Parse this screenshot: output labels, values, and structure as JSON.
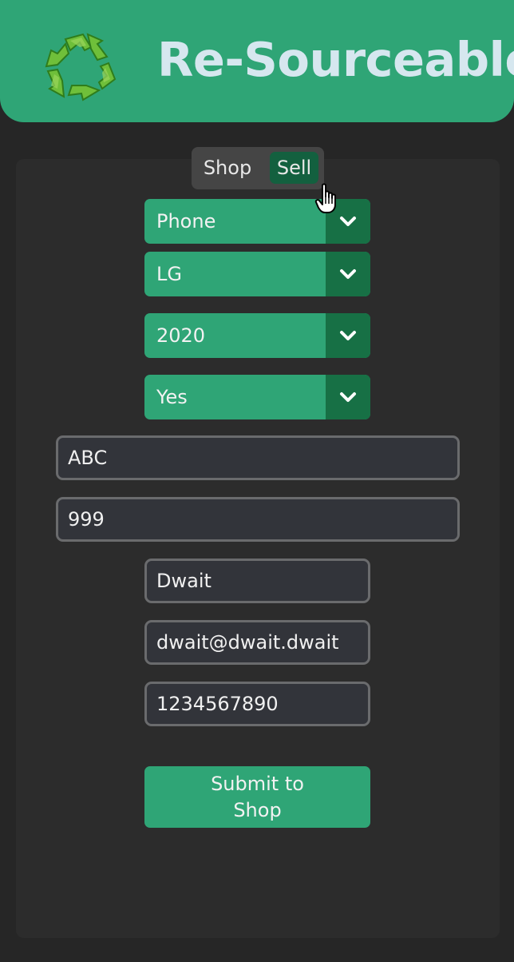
{
  "header": {
    "title": "Re-Sourceable",
    "logo_icon": "recycle-icon",
    "background": "#2fa576",
    "title_color": "#d6e7ef"
  },
  "mode_toggle": {
    "options": [
      "Shop",
      "Sell"
    ],
    "selected": "Sell",
    "selected_color": "#13603f"
  },
  "form": {
    "selects": [
      {
        "value": "Phone"
      },
      {
        "value": "LG"
      },
      {
        "value": "2020"
      },
      {
        "value": "Yes"
      }
    ],
    "wide_fields": [
      {
        "value": "ABC"
      },
      {
        "value": "999"
      }
    ],
    "contact_fields": [
      {
        "value": "Dwait"
      },
      {
        "value": "dwait@dwait.dwait"
      },
      {
        "value": "1234567890"
      }
    ],
    "submit_label": "Submit to Shop"
  },
  "accent_color": "#2fa576",
  "accent_dark": "#177045"
}
